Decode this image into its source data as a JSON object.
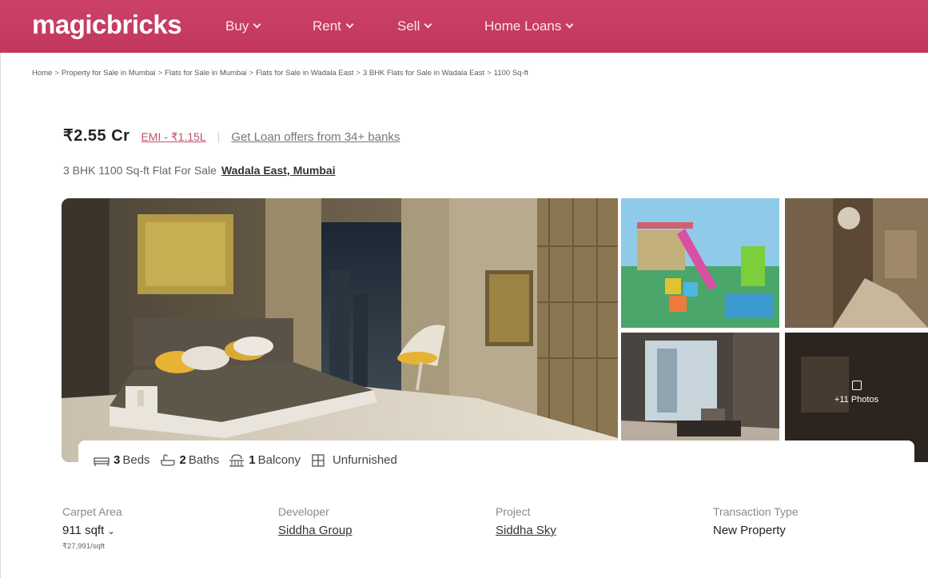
{
  "header": {
    "brand": "magicbricks",
    "nav": [
      {
        "label": "Buy"
      },
      {
        "label": "Rent"
      },
      {
        "label": "Sell"
      },
      {
        "label": "Home Loans"
      }
    ]
  },
  "breadcrumb": [
    "Home",
    "Property for Sale in Mumbai",
    "Flats for Sale in Mumbai",
    "Flats for Sale in Wadala East",
    "3 BHK Flats for Sale in Wadala East",
    "1100 Sq-ft"
  ],
  "breadcrumb_separator": ">",
  "listing": {
    "price": "₹2.55 Cr",
    "emi": "EMI - ₹1.15L",
    "divider": "|",
    "loan_offer": "Get Loan offers from 34+ banks",
    "title": "3 BHK 1100 Sq-ft Flat For Sale",
    "location": "Wadala East, Mumbai"
  },
  "gallery": {
    "more_photos": "+11 Photos"
  },
  "amenities": [
    {
      "icon": "bed-icon",
      "count": "3",
      "label": "Beds"
    },
    {
      "icon": "bath-icon",
      "count": "2",
      "label": "Baths"
    },
    {
      "icon": "balcony-icon",
      "count": "1",
      "label": "Balcony"
    },
    {
      "icon": "furnishing-icon",
      "count": "",
      "label": "Unfurnished"
    }
  ],
  "summary": {
    "carpet_area": {
      "label": "Carpet Area",
      "value": "911 sqft",
      "sub": "₹27,991/sqft"
    },
    "developer": {
      "label": "Developer",
      "value": "Siddha Group"
    },
    "project": {
      "label": "Project",
      "value": "Siddha Sky"
    },
    "transaction": {
      "label": "Transaction Type",
      "value": "New Property"
    }
  },
  "colors": {
    "brand": "#c73a62",
    "emi_link": "#c0506a"
  }
}
